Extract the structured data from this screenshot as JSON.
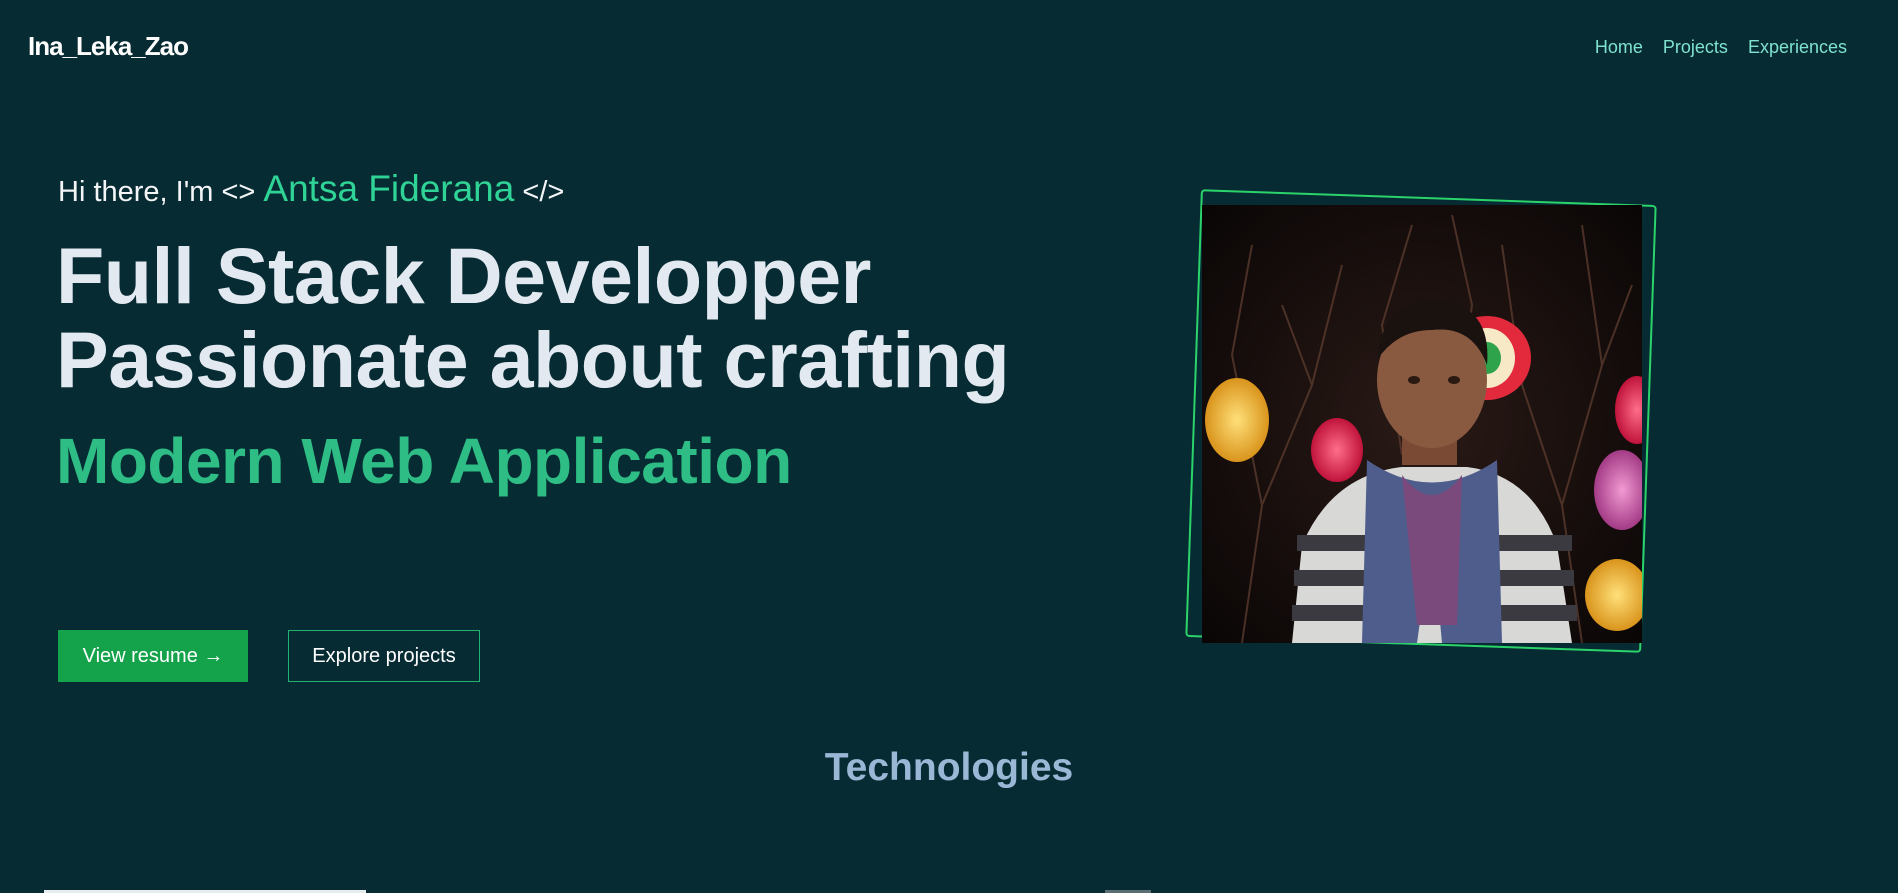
{
  "header": {
    "brand": "Ina_Leka_Zao",
    "nav": [
      "Home",
      "Projects",
      "Experiences"
    ]
  },
  "hero": {
    "greeting_prefix": "Hi there, I'm <>",
    "name": "Antsa Fiderana",
    "greeting_suffix": "</>",
    "headline_line1": "Full Stack Developper",
    "headline_line2": "Passionate about crafting",
    "subheadline": "Modern Web Application",
    "primary_button": "View resume →",
    "secondary_button": "Explore projects",
    "photo_icon": "profile-photo"
  },
  "technologies": {
    "title": "Technologies"
  },
  "colors": {
    "background": "#062b33",
    "accent": "#2ebd84",
    "nav_link": "#7fe3cf",
    "primary_button": "#14a34a",
    "frame": "#2bd36a"
  }
}
